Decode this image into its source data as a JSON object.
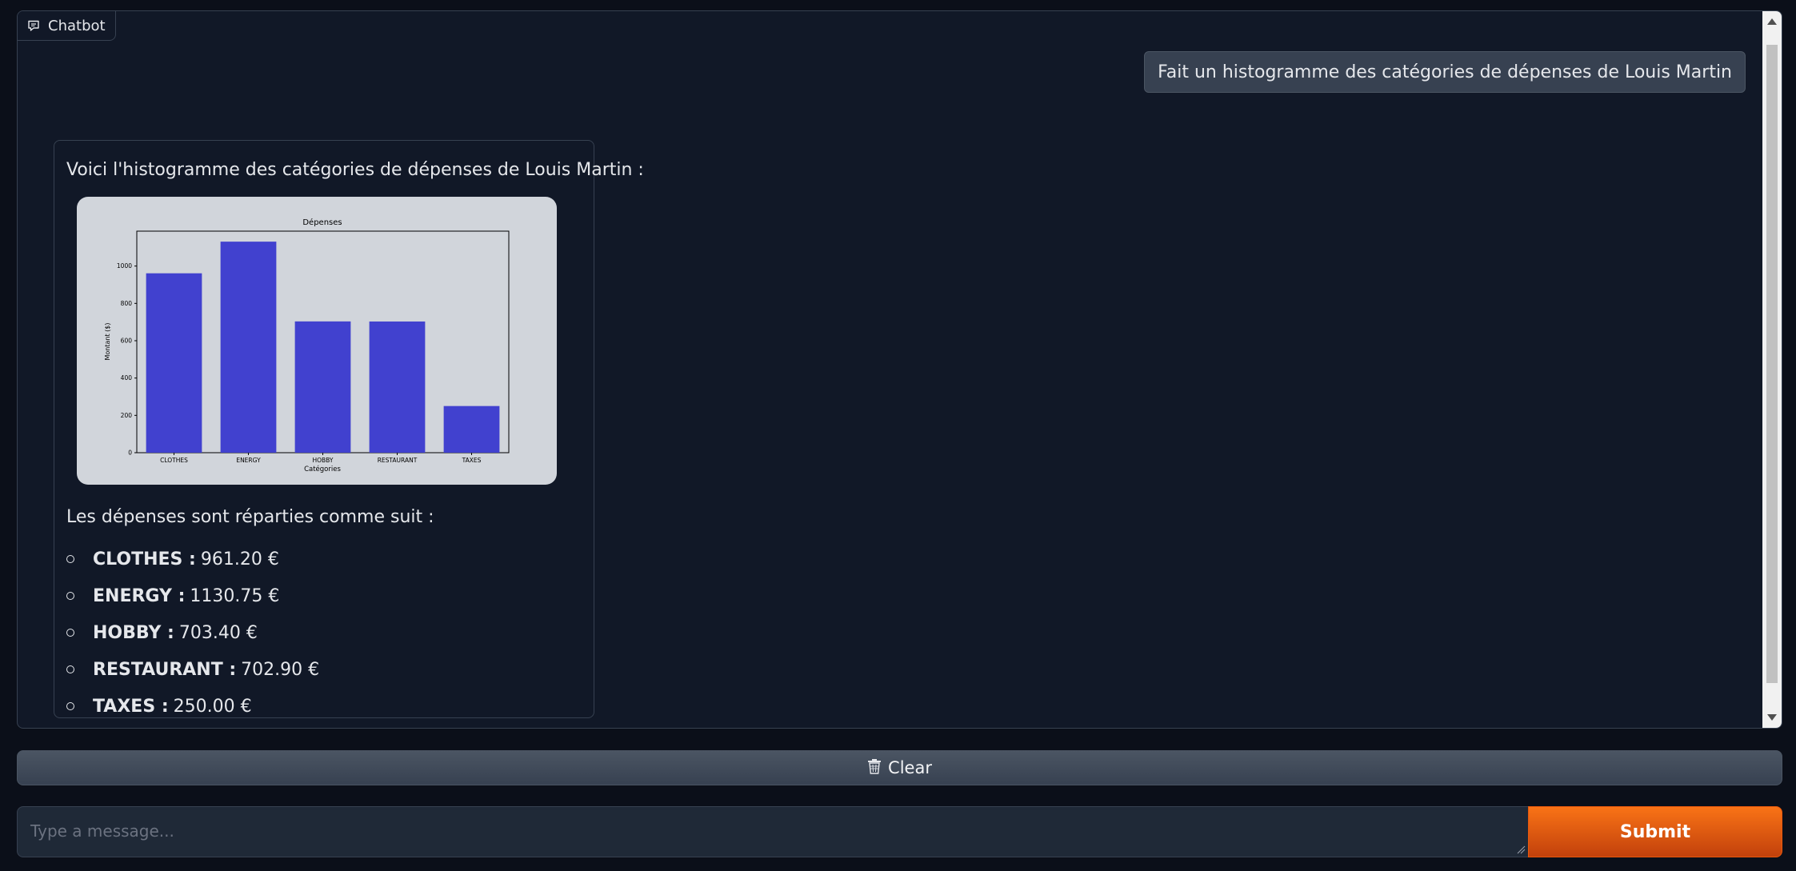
{
  "chatbot": {
    "label": "Chatbot",
    "icon": "chat-icon"
  },
  "messages": {
    "user": "Fait un histogramme des catégories de dépenses de Louis Martin",
    "bot_intro": "Voici l'histogramme des catégories de dépenses de Louis Martin :",
    "bot_summary": "Les dépenses sont réparties comme suit :",
    "items": [
      {
        "category": "CLOTHES :",
        "amount": "961.20 €"
      },
      {
        "category": "ENERGY :",
        "amount": "1130.75 €"
      },
      {
        "category": "HOBBY :",
        "amount": "703.40 €"
      },
      {
        "category": "RESTAURANT :",
        "amount": "702.90 €"
      },
      {
        "category": "TAXES :",
        "amount": "250.00 €"
      }
    ]
  },
  "chart_data": {
    "type": "bar",
    "title": "Dépenses",
    "xlabel": "Catégories",
    "ylabel": "Montant ($)",
    "categories": [
      "CLOTHES",
      "ENERGY",
      "HOBBY",
      "RESTAURANT",
      "TAXES"
    ],
    "values": [
      961.2,
      1130.75,
      703.4,
      702.9,
      250.0
    ],
    "yticks": [
      0,
      200,
      400,
      600,
      800,
      1000
    ],
    "ylim": [
      0,
      1187
    ],
    "bar_color": "#4141cf",
    "grid": false
  },
  "controls": {
    "clear_label": "Clear",
    "clear_icon": "trash-icon",
    "input_placeholder": "Type a message...",
    "input_value": "",
    "submit_label": "Submit"
  },
  "colors": {
    "background": "#0b0f19",
    "panel": "#111827",
    "accent": "#f97316"
  }
}
